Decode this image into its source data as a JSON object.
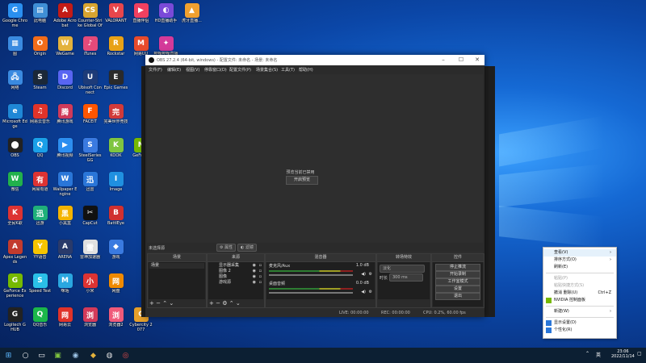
{
  "desktop_icons": [
    [
      "Google Chrome",
      "#2a8ff0",
      "G"
    ],
    [
      "此电脑",
      "#3f8fd6",
      "▤"
    ],
    [
      "Adobe Acrobat",
      "#c21b17",
      "A"
    ],
    [
      "Counter-Strike Global Offe...",
      "#d8a430",
      "CS"
    ],
    [
      "VALORANT",
      "#e8464c",
      "V"
    ],
    [
      "直播伴侣",
      "#f04060",
      "▶"
    ],
    [
      "HD直播助手",
      "#7a4ad8",
      "◐"
    ],
    [
      "虎牙直播...",
      "#f0a030",
      "▲"
    ],
    [
      "图",
      "#3a8ae0",
      "▦"
    ],
    [
      "Origin",
      "#f26c1a",
      "O"
    ],
    [
      "WeGame",
      "#e3b23c",
      "W"
    ],
    [
      "iTunes",
      "#e34a7a",
      "♪"
    ],
    [
      "Rockstar",
      "#e8a217",
      "R"
    ],
    [
      "网易UU",
      "#e84b2c",
      "M"
    ],
    [
      "哔哩哔哩直播",
      "#d43a9a",
      "✦"
    ],
    [
      "网络",
      "#3a8ae0",
      "🖧"
    ],
    [
      "Steam",
      "#1b2838",
      "S"
    ],
    [
      "Discord",
      "#5865f2",
      "D"
    ],
    [
      "Ubisoft Connect",
      "#1d3b78",
      "U"
    ],
    [
      "Epic Games",
      "#2a2a2a",
      "E"
    ],
    [
      "Microsoft Edge",
      "#1f87d6",
      "e"
    ],
    [
      "网易云音乐",
      "#e0332a",
      "♫"
    ],
    [
      "腾讯游戏",
      "#d03a5a",
      "腾"
    ],
    [
      "FACEIT",
      "#ff5500",
      "F"
    ],
    [
      "完美世界竞技",
      "#d13a3a",
      "完"
    ],
    [
      "OBS",
      "#222",
      "⬤"
    ],
    [
      "QQ",
      "#1aa0e8",
      "Q"
    ],
    [
      "腾讯视频",
      "#2c8ef0",
      "▶"
    ],
    [
      "SteelSeries GG",
      "#3a7ae0",
      "S"
    ],
    [
      "KOOK",
      "#7fc540",
      "K"
    ],
    [
      "GeForce",
      "#76b900",
      "N"
    ],
    [
      "微信",
      "#22b14c",
      "W"
    ],
    [
      "网易有道",
      "#d33",
      "有"
    ],
    [
      "Wallpaper Engine",
      "#2a76d8",
      "W"
    ],
    [
      "迅雷",
      "#2a76d8",
      "迅"
    ],
    [
      "Image",
      "#2090e0",
      "I"
    ],
    [
      "全民K歌",
      "#d33",
      "K"
    ],
    [
      "迅游",
      "#1fb07a",
      "迅"
    ],
    [
      "小黑盒",
      "#f4b400",
      "黑"
    ],
    [
      "CapCut",
      "#111",
      "✂"
    ],
    [
      "BattlEye",
      "#d03030",
      "B"
    ],
    [
      "Apex Legends",
      "#c23b2e",
      "A"
    ],
    [
      "YY语音",
      "#f5c400",
      "Y"
    ],
    [
      "ARENA",
      "#2a3a6a",
      "A"
    ],
    [
      "雷神加速器",
      "#e0e0e0",
      "雷"
    ],
    [
      "游戏",
      "#3a7ae0",
      "◆"
    ],
    [
      "GeForce Experience",
      "#76b900",
      "G"
    ],
    [
      "Speed Test",
      "#2ac0e8",
      "S"
    ],
    [
      "咪咕",
      "#2aa7e0",
      "M"
    ],
    [
      "小米",
      "#d33",
      "小"
    ],
    [
      "网盘",
      "#f08a00",
      "网"
    ],
    [
      "Logitech G HUB",
      "#222",
      "G"
    ],
    [
      "QQ音乐",
      "#1bb74a",
      "Q"
    ],
    [
      "网易云",
      "#e0332a",
      "网"
    ],
    [
      "浏览器",
      "#d33a5a",
      "浏"
    ],
    [
      "浏览器2",
      "#f05a7a",
      "浏"
    ],
    [
      "Cybercity 2077",
      "#e6a02a",
      "C"
    ],
    [
      "Ruler",
      "#555",
      "R"
    ]
  ],
  "obs": {
    "title": "OBS 27.2.4 (64-bit, windows) - 配置文件: 未命名 - 场景: 未命名",
    "menu": [
      "文件(F)",
      "编辑(E)",
      "视图(V)",
      "停靠窗口(D)",
      "配置文件(P)",
      "场景集合(S)",
      "工具(T)",
      "帮助(H)"
    ],
    "preview_msg": "预览当前已禁用",
    "preview_btn": "开启预览",
    "no_source": "未选择源",
    "prop_btn": "⚙ 属性",
    "filter_btn": "◐ 滤镜",
    "docks": {
      "scenes": "场景",
      "sources": "来源",
      "mixer": "混音器",
      "transitions": "转场特效",
      "controls": "控件"
    },
    "scene_item": "场景",
    "sources": [
      "显示器采集",
      "图像 2",
      "图像",
      "游戏源"
    ],
    "mixer": [
      {
        "name": "麦克风/Aux",
        "db": "1.0 dB"
      },
      {
        "name": "桌面音频",
        "db": "0.0 dB"
      }
    ],
    "transition": "淡化",
    "duration_label": "时长",
    "duration": "300 ms",
    "controls": [
      "停止推流",
      "开始录制",
      "工作室模式",
      "设置",
      "退出"
    ],
    "status": {
      "live": "LIVE: 00:00:00",
      "rec": "REC: 00:00:00",
      "cpu": "CPU: 0.2%, 60.00 fps"
    }
  },
  "context_menu": [
    {
      "label": "查看(V)",
      "arrow": "›",
      "disabled": false,
      "highlight": true
    },
    {
      "label": "排序方式(O)",
      "arrow": "›",
      "disabled": false
    },
    {
      "label": "刷新(E)",
      "arrow": "",
      "disabled": false
    },
    {
      "sep": true
    },
    {
      "label": "粘贴(P)",
      "arrow": "",
      "disabled": true
    },
    {
      "label": "粘贴快捷方式(S)",
      "arrow": "",
      "disabled": true
    },
    {
      "label": "撤消 删除(U)",
      "shortcut": "Ctrl+Z",
      "disabled": false
    },
    {
      "label": "NVIDIA 控制面板",
      "arrow": "",
      "disabled": false,
      "icon": "#76b900"
    },
    {
      "sep": true
    },
    {
      "label": "新建(W)",
      "arrow": "›",
      "disabled": false
    },
    {
      "sep": true
    },
    {
      "label": "显示设置(D)",
      "arrow": "",
      "disabled": false,
      "icon": "#2a76d8"
    },
    {
      "label": "个性化(R)",
      "arrow": "",
      "disabled": false,
      "icon": "#2a76d8"
    }
  ],
  "taskbar": {
    "ime": "英",
    "time": "23:06",
    "date": "2022/11/14"
  }
}
